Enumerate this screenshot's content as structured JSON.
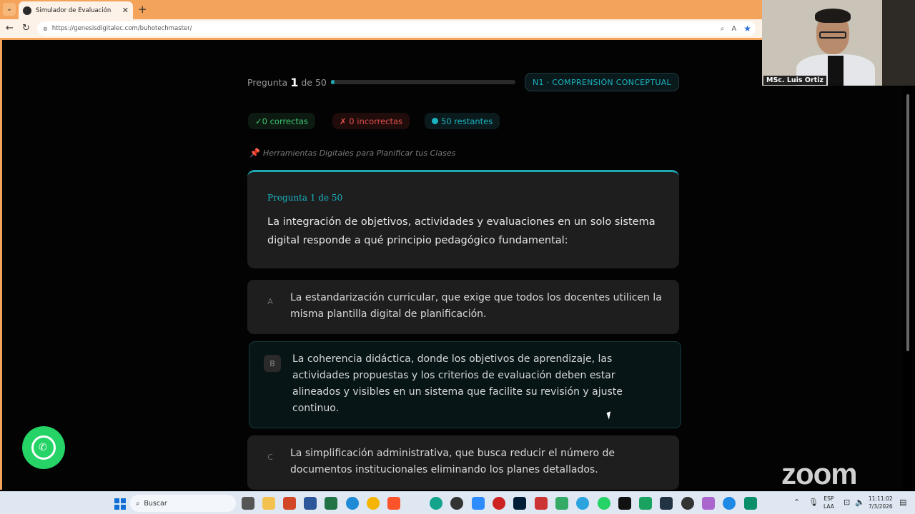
{
  "browser": {
    "tab_title": "Simulador de Evaluación",
    "tab_close": "✕",
    "new_tab": "+",
    "url": "https://genesisdigitalec.com/buhotechmaster/"
  },
  "quiz": {
    "progress_prefix": "Pregunta",
    "progress_current": "1",
    "progress_suffix": "de 50",
    "progress_fraction": 0.02,
    "level_badge": "N1 · COMPRENSIÓN CONCEPTUAL",
    "stats": {
      "correct": "✓0 correctas",
      "incorrect": "✗ 0 incorrectas",
      "remaining": "50 restantes"
    },
    "topic": "Herramientas Digitales para Planificar tus Clases",
    "question_label": "Pregunta 1 de 50",
    "question_text": "La integración de objetivos, actividades y evaluaciones en un solo sistema digital responde a qué principio pedagógico fundamental:",
    "options": [
      {
        "letter": "A",
        "text": "La estandarización curricular, que exige que todos los docentes utilicen la misma plantilla digital de planificación."
      },
      {
        "letter": "B",
        "text": "La coherencia didáctica, donde los objetivos de aprendizaje, las actividades propuestas y los criterios de evaluación deben estar alineados y visibles en un sistema que facilite su revisión y ajuste continuo."
      },
      {
        "letter": "C",
        "text": "La simplificación administrativa, que busca reducir el número de documentos institucionales eliminando los planes detallados."
      }
    ]
  },
  "video": {
    "participant_name": "MSc. Luis Ortiz"
  },
  "overlay": {
    "zoom_logo": "zoom"
  },
  "taskbar": {
    "search_label": "Buscar",
    "lang_top": "ESP",
    "lang_bottom": "LAA",
    "time": "11:11:02",
    "date": "7/3/2026"
  },
  "colors": {
    "accent": "#1bb3c0",
    "correct": "#3ec46d",
    "incorrect": "#e0504c",
    "browser_chrome": "#f4a35a"
  }
}
